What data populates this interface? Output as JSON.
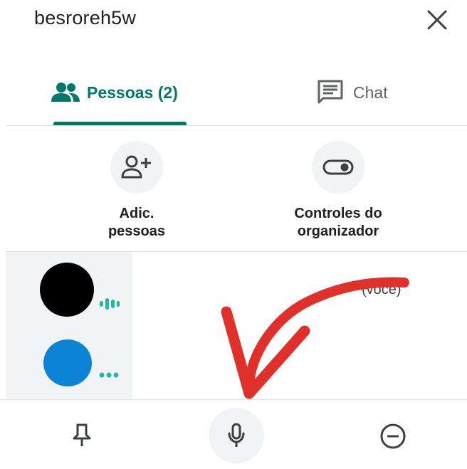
{
  "header": {
    "title": "besroreh5w"
  },
  "tabs": [
    {
      "label": "Pessoas (2)",
      "icon": "people-icon",
      "active": true
    },
    {
      "label": "Chat",
      "icon": "chat-icon",
      "active": false
    }
  ],
  "actions": {
    "add_people": {
      "line1": "Adic.",
      "line2": "pessoas",
      "icon": "add-person-icon"
    },
    "host_controls": {
      "line1": "Controles do",
      "line2": "organizador",
      "icon": "toggle-icon"
    }
  },
  "participants": [
    {
      "avatar_color": "#000000",
      "status": "speaking-indicator"
    },
    {
      "avatar_color": "#0b84d6",
      "status": "more-dots",
      "you_label": "(você)"
    }
  ],
  "bottom_bar": [
    {
      "icon": "pin-icon"
    },
    {
      "icon": "microphone-icon",
      "highlighted": true
    },
    {
      "icon": "remove-icon"
    }
  ],
  "colors": {
    "accent": "#00796b",
    "annotation_arrow": "#e0302a",
    "surface": "#f1f3f4"
  }
}
